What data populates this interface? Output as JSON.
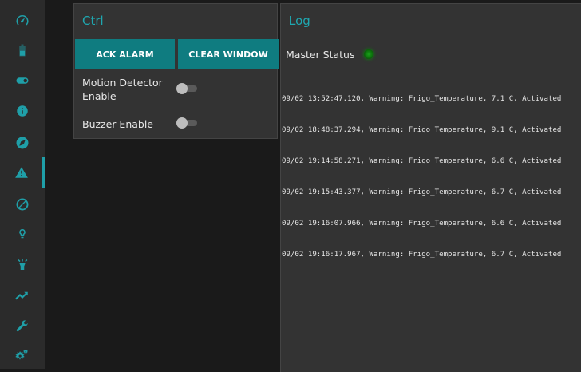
{
  "sidebar": {
    "items": [
      {
        "icon": "dashboard-icon"
      },
      {
        "icon": "battery-icon"
      },
      {
        "icon": "toggle-icon"
      },
      {
        "icon": "info-icon"
      },
      {
        "icon": "compass-icon"
      },
      {
        "icon": "warning-icon",
        "active": true
      },
      {
        "icon": "block-icon"
      },
      {
        "icon": "lightbulb-icon"
      },
      {
        "icon": "lamp-icon"
      },
      {
        "icon": "trend-icon"
      },
      {
        "icon": "wrench-icon"
      },
      {
        "icon": "cogs-icon"
      }
    ]
  },
  "ctrl": {
    "title": "Ctrl",
    "ack_label": "ACK ALARM",
    "clear_label": "CLEAR WINDOW",
    "motion_label": "Motion Detector Enable",
    "motion_enabled": false,
    "buzzer_label": "Buzzer Enable",
    "buzzer_enabled": false
  },
  "log": {
    "title": "Log",
    "master_status_label": "Master Status",
    "master_status_color": "#1aa01a",
    "lines": [
      "09/02 13:52:47.120, Warning: Frigo_Temperature, 7.1 C, Activated",
      "09/02 18:48:37.294, Warning: Frigo_Temperature, 9.1 C, Activated",
      "09/02 19:14:58.271, Warning: Frigo_Temperature, 6.6 C, Activated",
      "09/02 19:15:43.377, Warning: Frigo_Temperature, 6.7 C, Activated",
      "09/02 19:16:07.966, Warning: Frigo_Temperature, 6.6 C, Activated",
      "09/02 19:16:17.967, Warning: Frigo_Temperature, 6.7 C, Activated"
    ]
  },
  "colors": {
    "accent": "#1f9fa8",
    "button": "#0f7c80",
    "panel": "#333333",
    "sidebar": "#2b2b2b",
    "background": "#1a1a1a"
  }
}
